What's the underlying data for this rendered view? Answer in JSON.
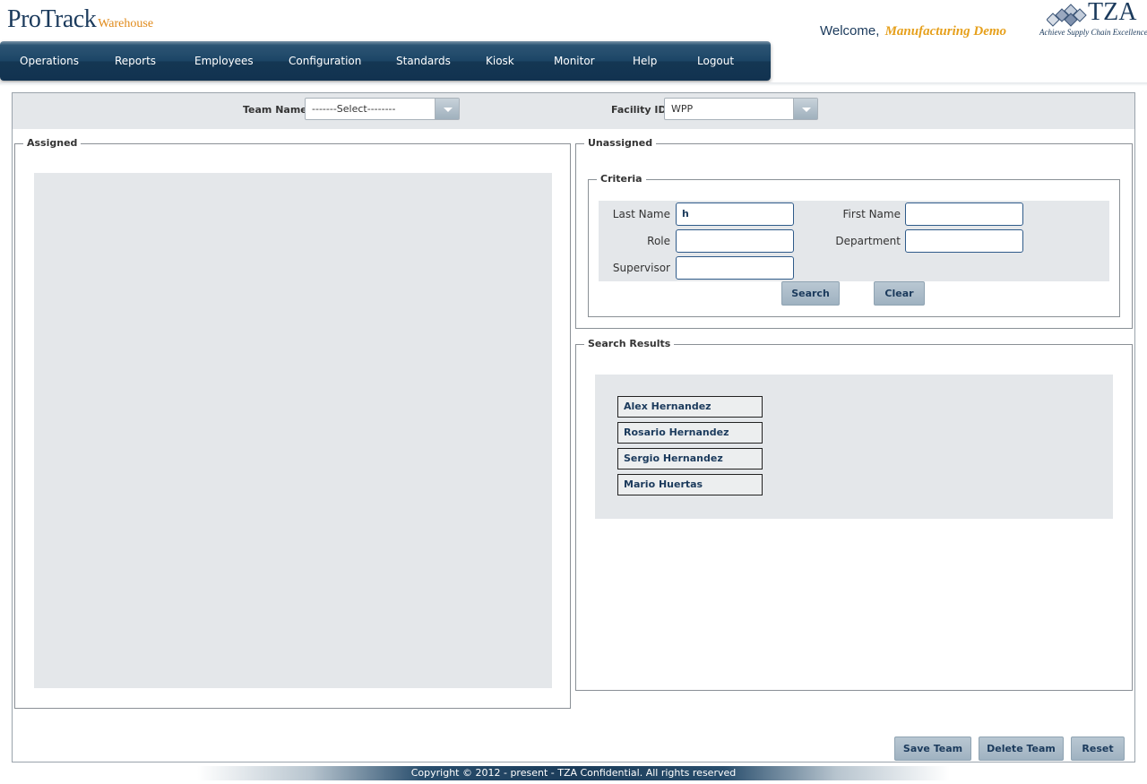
{
  "header": {
    "logo_main": "ProTrack",
    "logo_sub": "Warehouse",
    "welcome_label": "Welcome,",
    "welcome_user": "Manufacturing Demo",
    "brand": "TZA",
    "brand_tagline": "Achieve Supply Chain Excellence"
  },
  "nav": {
    "items": [
      "Operations",
      "Reports",
      "Employees",
      "Configuration",
      "Standards",
      "Kiosk",
      "Monitor",
      "Help",
      "Logout"
    ]
  },
  "filters": {
    "team_label": "Team Name",
    "team_value": "-------Select--------",
    "facility_label": "Facility ID",
    "facility_value": "WPP"
  },
  "assigned": {
    "legend": "Assigned"
  },
  "unassigned": {
    "legend": "Unassigned",
    "criteria_legend": "Criteria",
    "fields": {
      "last_name_label": "Last Name",
      "last_name_value": "h",
      "first_name_label": "First Name",
      "first_name_value": "",
      "role_label": "Role",
      "role_value": "",
      "department_label": "Department",
      "department_value": "",
      "supervisor_label": "Supervisor",
      "supervisor_value": ""
    },
    "search_button": "Search",
    "clear_button": "Clear"
  },
  "results": {
    "legend": "Search Results",
    "items": [
      "Alex Hernandez",
      "Rosario Hernandez",
      "Sergio Hernandez",
      "Mario Huertas"
    ]
  },
  "actions": {
    "save": "Save Team",
    "delete": "Delete Team",
    "reset": "Reset"
  },
  "footer": {
    "text": "Copyright © 2012 - present - TZA Confidential. All rights reserved"
  },
  "colors": {
    "nav_bg": "#1c4566",
    "accent_orange": "#e6a01c",
    "brand_navy": "#1b3a5c",
    "panel_gray": "#e4e7ea"
  }
}
